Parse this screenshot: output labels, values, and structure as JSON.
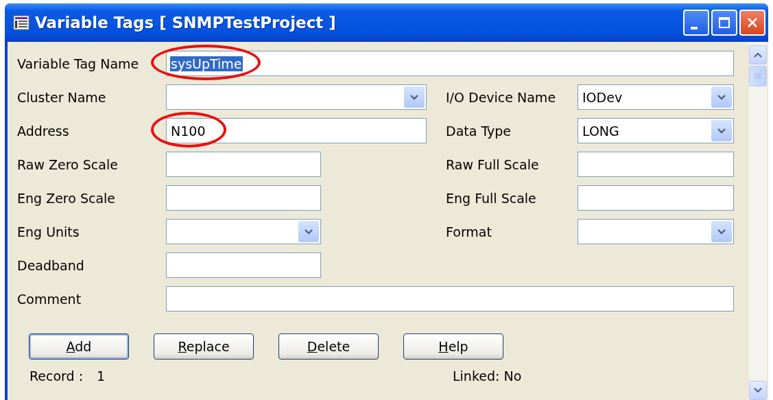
{
  "window": {
    "title": "Variable Tags [ SNMPTestProject ]"
  },
  "rows": [
    {
      "kind": "wide",
      "left": {
        "label": "Variable Tag Name",
        "field": {
          "kind": "text",
          "value": "sysUpTime",
          "value_selected": true,
          "circled": true
        }
      }
    },
    {
      "kind": "pair",
      "left": {
        "label": "Cluster Name",
        "field": {
          "kind": "combo"
        }
      },
      "right": {
        "label": "I/O Device Name",
        "field": {
          "kind": "combo",
          "value": "IODev"
        }
      }
    },
    {
      "kind": "pair",
      "left": {
        "label": "Address",
        "field": {
          "kind": "text",
          "value": "N100",
          "circled": true
        }
      },
      "right": {
        "label": "Data Type",
        "field": {
          "kind": "combo",
          "value": "LONG"
        }
      }
    },
    {
      "kind": "pair",
      "left": {
        "label": "Raw Zero Scale",
        "field": {
          "kind": "short_text"
        }
      },
      "right": {
        "label": "Raw Full Scale",
        "field": {
          "kind": "text"
        }
      }
    },
    {
      "kind": "pair",
      "left": {
        "label": "Eng Zero Scale",
        "field": {
          "kind": "short_text"
        }
      },
      "right": {
        "label": "Eng Full Scale",
        "field": {
          "kind": "text"
        }
      }
    },
    {
      "kind": "pair",
      "left": {
        "label": "Eng Units",
        "field": {
          "kind": "short_combo"
        }
      },
      "right": {
        "label": "Format",
        "field": {
          "kind": "combo"
        }
      }
    },
    {
      "kind": "pair",
      "left": {
        "label": "Deadband",
        "field": {
          "kind": "short_text"
        }
      }
    },
    {
      "kind": "wide",
      "left": {
        "label": "Comment",
        "field": {
          "kind": "text"
        }
      }
    }
  ],
  "buttons": [
    {
      "label": "Add",
      "default": true,
      "first_letter_underlined": true
    },
    {
      "label": "Replace",
      "default": false,
      "first_letter_underlined": true
    },
    {
      "label": "Delete",
      "default": false,
      "first_letter_underlined": true
    },
    {
      "label": "Help",
      "default": false,
      "first_letter_underlined": true
    }
  ],
  "status_bar": {
    "record_label": "Record :",
    "record_value": "1",
    "linked": "Linked: No"
  }
}
